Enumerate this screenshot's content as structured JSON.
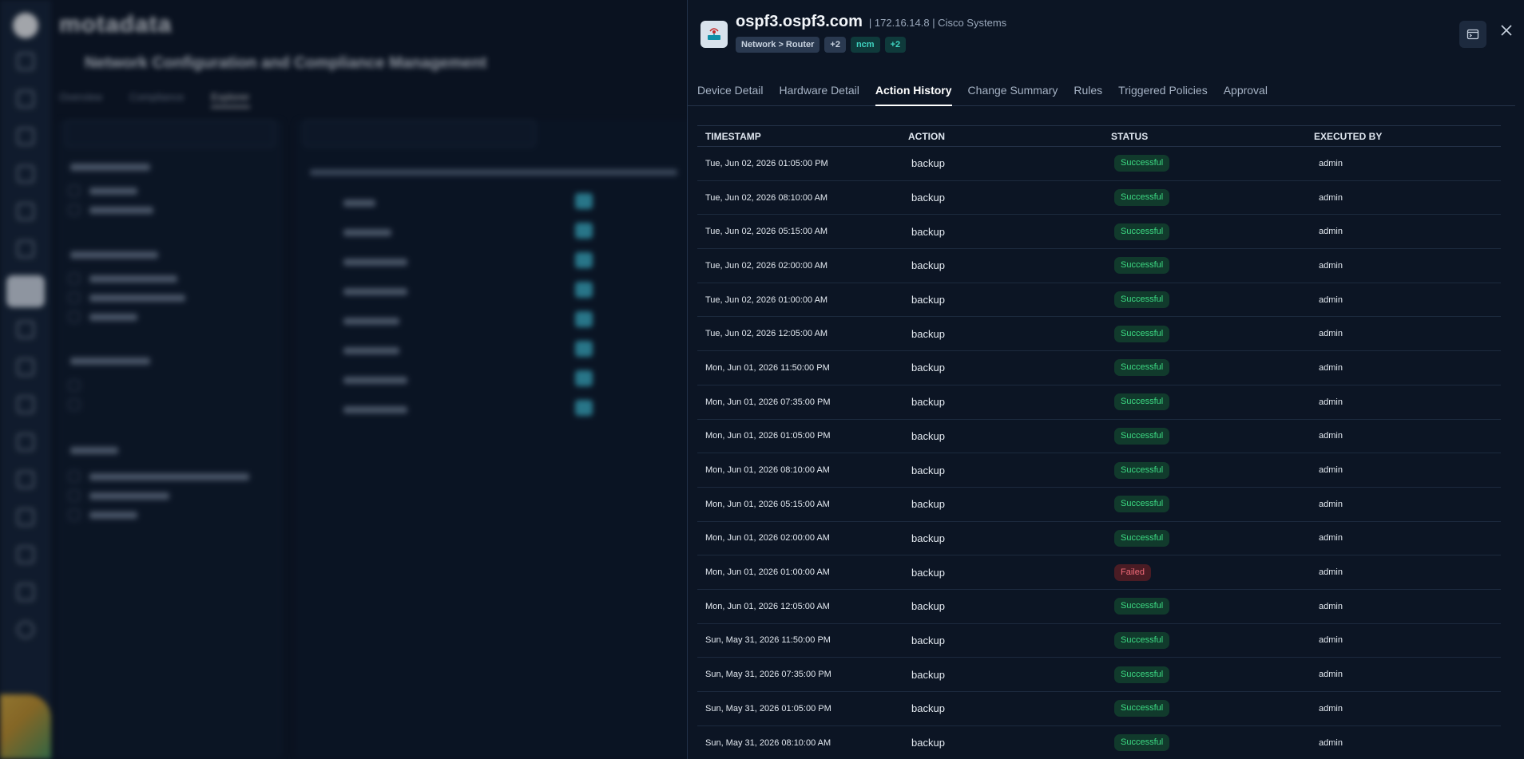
{
  "background": {
    "brand": "motadata",
    "page_title": "Network Configuration and Compliance Management",
    "tabs": [
      "Overview",
      "Compliance",
      "Explorer"
    ]
  },
  "drawer": {
    "device_name": "ospf3.ospf3.com",
    "device_meta": "| 172.16.14.8 | Cisco Systems",
    "tags": [
      {
        "label": "Network > Router",
        "style": "gray"
      },
      {
        "label": "+2",
        "style": "gray"
      },
      {
        "label": "ncm",
        "style": "teal"
      },
      {
        "label": "+2",
        "style": "teal"
      }
    ],
    "tabs": [
      "Device Detail",
      "Hardware Detail",
      "Action History",
      "Change Summary",
      "Rules",
      "Triggered Policies",
      "Approval"
    ],
    "active_tab": "Action History",
    "table": {
      "headers": [
        "TIMESTAMP",
        "ACTION",
        "STATUS",
        "EXECUTED BY"
      ],
      "rows": [
        {
          "timestamp": "Tue, Jun 02, 2026 01:05:00 PM",
          "action": "backup",
          "status": "Successful",
          "by": "admin"
        },
        {
          "timestamp": "Tue, Jun 02, 2026 08:10:00 AM",
          "action": "backup",
          "status": "Successful",
          "by": "admin"
        },
        {
          "timestamp": "Tue, Jun 02, 2026 05:15:00 AM",
          "action": "backup",
          "status": "Successful",
          "by": "admin"
        },
        {
          "timestamp": "Tue, Jun 02, 2026 02:00:00 AM",
          "action": "backup",
          "status": "Successful",
          "by": "admin"
        },
        {
          "timestamp": "Tue, Jun 02, 2026 01:00:00 AM",
          "action": "backup",
          "status": "Successful",
          "by": "admin"
        },
        {
          "timestamp": "Tue, Jun 02, 2026 12:05:00 AM",
          "action": "backup",
          "status": "Successful",
          "by": "admin"
        },
        {
          "timestamp": "Mon, Jun 01, 2026 11:50:00 PM",
          "action": "backup",
          "status": "Successful",
          "by": "admin"
        },
        {
          "timestamp": "Mon, Jun 01, 2026 07:35:00 PM",
          "action": "backup",
          "status": "Successful",
          "by": "admin"
        },
        {
          "timestamp": "Mon, Jun 01, 2026 01:05:00 PM",
          "action": "backup",
          "status": "Successful",
          "by": "admin"
        },
        {
          "timestamp": "Mon, Jun 01, 2026 08:10:00 AM",
          "action": "backup",
          "status": "Successful",
          "by": "admin"
        },
        {
          "timestamp": "Mon, Jun 01, 2026 05:15:00 AM",
          "action": "backup",
          "status": "Successful",
          "by": "admin"
        },
        {
          "timestamp": "Mon, Jun 01, 2026 02:00:00 AM",
          "action": "backup",
          "status": "Successful",
          "by": "admin"
        },
        {
          "timestamp": "Mon, Jun 01, 2026 01:00:00 AM",
          "action": "backup",
          "status": "Failed",
          "by": "admin"
        },
        {
          "timestamp": "Mon, Jun 01, 2026 12:05:00 AM",
          "action": "backup",
          "status": "Successful",
          "by": "admin"
        },
        {
          "timestamp": "Sun, May 31, 2026 11:50:00 PM",
          "action": "backup",
          "status": "Successful",
          "by": "admin"
        },
        {
          "timestamp": "Sun, May 31, 2026 07:35:00 PM",
          "action": "backup",
          "status": "Successful",
          "by": "admin"
        },
        {
          "timestamp": "Sun, May 31, 2026 01:05:00 PM",
          "action": "backup",
          "status": "Successful",
          "by": "admin"
        },
        {
          "timestamp": "Sun, May 31, 2026 08:10:00 AM",
          "action": "backup",
          "status": "Successful",
          "by": "admin"
        }
      ]
    }
  },
  "icons": {
    "device": "router-icon",
    "terminal": "terminal-icon",
    "close": "close-icon"
  }
}
